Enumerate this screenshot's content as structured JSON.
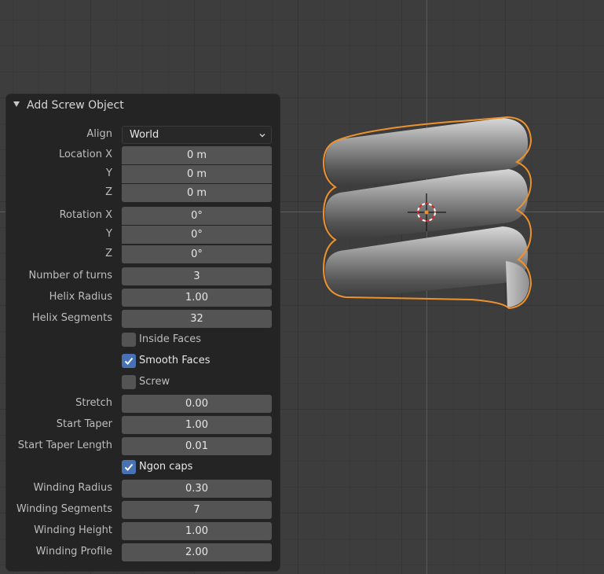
{
  "panel": {
    "title": "Add Screw Object",
    "align": {
      "label": "Align",
      "value": "World"
    },
    "location": {
      "label_x": "Location X",
      "label_y": "Y",
      "label_z": "Z",
      "x": "0 m",
      "y": "0 m",
      "z": "0 m"
    },
    "rotation": {
      "label_x": "Rotation X",
      "label_y": "Y",
      "label_z": "Z",
      "x": "0°",
      "y": "0°",
      "z": "0°"
    },
    "number_of_turns": {
      "label": "Number of turns",
      "value": "3"
    },
    "helix_radius": {
      "label": "Helix Radius",
      "value": "1.00"
    },
    "helix_segments": {
      "label": "Helix Segments",
      "value": "32"
    },
    "inside_faces": {
      "label": "Inside Faces",
      "checked": false
    },
    "smooth_faces": {
      "label": "Smooth Faces",
      "checked": true
    },
    "screw": {
      "label": "Screw",
      "checked": false
    },
    "stretch": {
      "label": "Stretch",
      "value": "0.00"
    },
    "start_taper": {
      "label": "Start Taper",
      "value": "1.00"
    },
    "start_taper_length": {
      "label": "Start Taper Length",
      "value": "0.01"
    },
    "ngon_caps": {
      "label": "Ngon caps",
      "checked": true
    },
    "winding_radius": {
      "label": "Winding Radius",
      "value": "0.30"
    },
    "winding_segments": {
      "label": "Winding Segments",
      "value": "7"
    },
    "winding_height": {
      "label": "Winding Height",
      "value": "1.00"
    },
    "winding_profile": {
      "label": "Winding Profile",
      "value": "2.00"
    }
  },
  "viewport": {
    "selection_outline_color": "#f0922c",
    "x_axis_color": "#b0373b",
    "y_axis_color": "#3d5f9a",
    "object_icon": "screw-mesh",
    "cursor_icon": "3d-cursor-icon"
  }
}
